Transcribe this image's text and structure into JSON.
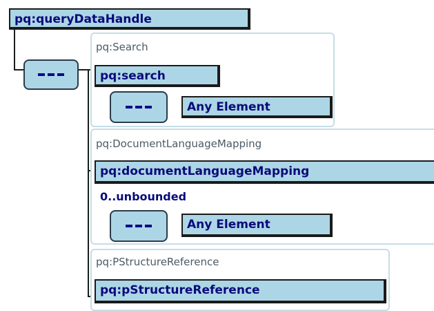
{
  "diagram": {
    "root": {
      "label": "pq:queryDataHandle"
    },
    "sequence_icons": [
      "sequence-icon",
      "sequence-icon",
      "sequence-icon"
    ],
    "panels": [
      {
        "type_name": "pq:Search",
        "element": "pq:search",
        "any": "Any Element"
      },
      {
        "type_name": "pq:DocumentLanguageMapping",
        "element": "pq:documentLanguageMapping",
        "cardinality": "0..unbounded",
        "any": "Any Element"
      },
      {
        "type_name": "pq:PStructureReference",
        "element": "pq:pStructureReference"
      }
    ]
  }
}
